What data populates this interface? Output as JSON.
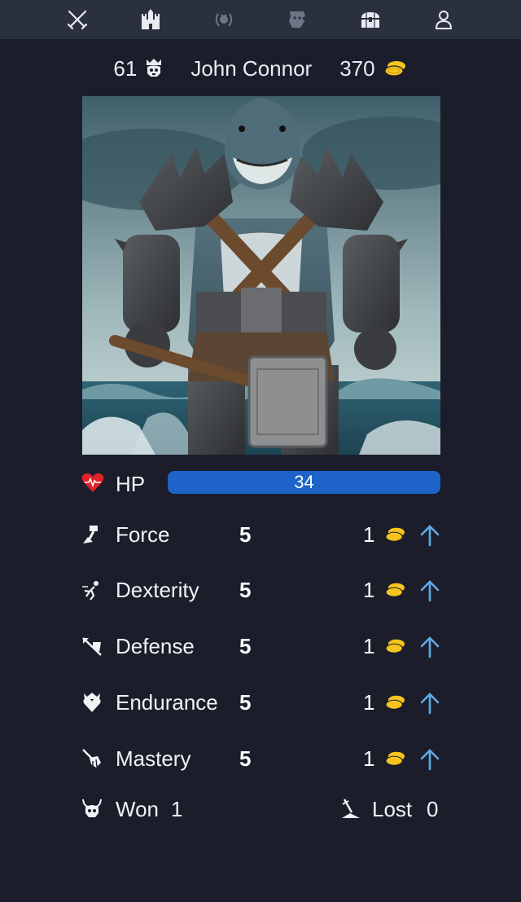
{
  "nav": {
    "items": [
      {
        "name": "battle",
        "icon": "crossed-swords-icon"
      },
      {
        "name": "castle",
        "icon": "castle-icon"
      },
      {
        "name": "ranking",
        "icon": "laurel-crest-icon"
      },
      {
        "name": "bestiary",
        "icon": "beast-icon"
      },
      {
        "name": "treasure",
        "icon": "treasure-chest-icon"
      },
      {
        "name": "profile",
        "icon": "user-icon"
      }
    ]
  },
  "player": {
    "level": "61",
    "name": "John Connor",
    "gold": "370",
    "level_icon": "skull-crown-icon",
    "gold_icon": "coins-icon"
  },
  "hp": {
    "label": "HP",
    "value": "34",
    "icon": "heart-icon",
    "color": "#1e64c8"
  },
  "stats": [
    {
      "name": "Force",
      "value": "5",
      "cost": "1",
      "icon": "hammer-arm-icon"
    },
    {
      "name": "Dexterity",
      "value": "5",
      "cost": "1",
      "icon": "running-figure-icon"
    },
    {
      "name": "Defense",
      "value": "5",
      "cost": "1",
      "icon": "shield-arrow-icon"
    },
    {
      "name": "Endurance",
      "value": "5",
      "cost": "1",
      "icon": "heart-crown-icon"
    },
    {
      "name": "Mastery",
      "value": "5",
      "cost": "1",
      "icon": "sword-hand-icon"
    }
  ],
  "record": {
    "won_label": "Won",
    "won_value": "1",
    "lost_label": "Lost",
    "lost_value": "0",
    "won_icon": "horned-skull-icon",
    "lost_icon": "fallen-sword-icon"
  },
  "colors": {
    "background": "#1b1e2a",
    "nav_background": "#2b303f",
    "gold": "#f6c51d",
    "arrow": "#5ea9e6",
    "heart": "#e0232b"
  }
}
